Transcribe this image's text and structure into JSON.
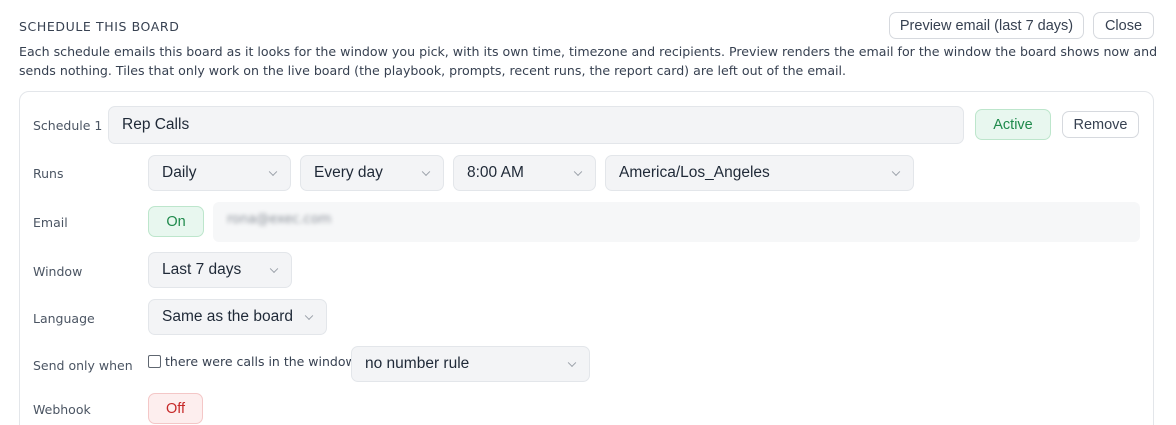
{
  "header": {
    "title": "SCHEDULE THIS BOARD",
    "preview_label": "Preview email (last 7 days)",
    "close_label": "Close"
  },
  "description": "Each schedule emails this board as it looks for the window you pick, with its own time, timezone and recipients. Preview renders the email for the window the board shows now and sends nothing. Tiles that only work on the live board (the playbook, prompts, recent runs, the report card) are left out of the email.",
  "schedule": {
    "label": "Schedule 1",
    "name": "Rep Calls",
    "status_label": "Active",
    "remove_label": "Remove",
    "runs": {
      "label": "Runs",
      "frequency": "Daily",
      "days": "Every day",
      "time": "8:00 AM",
      "timezone": "America/Los_Angeles"
    },
    "email": {
      "label": "Email",
      "toggle": "On",
      "recipient": "rona@exec.com"
    },
    "window": {
      "label": "Window",
      "value": "Last 7 days"
    },
    "language": {
      "label": "Language",
      "value": "Same as the board"
    },
    "send_only_when": {
      "label": "Send only when",
      "checkbox_label": "there were calls in the window",
      "checked": false,
      "rule": "no number rule"
    },
    "webhook": {
      "label": "Webhook",
      "toggle": "Off"
    }
  },
  "colors": {
    "active_green": "#1f8a4c",
    "off_red": "#c62828",
    "field_bg": "#f3f4f6"
  }
}
